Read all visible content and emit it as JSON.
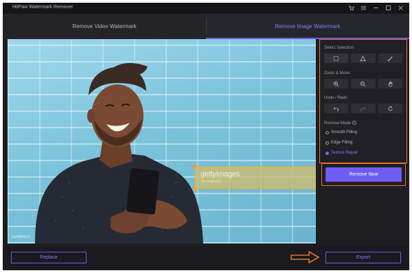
{
  "window": {
    "title": "HitPaw Watermark Remover"
  },
  "title_controls": [
    "cart-icon",
    "menu-icon",
    "minimize-icon",
    "maximize-icon",
    "close-icon"
  ],
  "tabs": [
    {
      "label": "Remove Video Watermark",
      "active": false
    },
    {
      "label": "Remove Image Watermark",
      "active": true
    }
  ],
  "canvas": {
    "watermark_text": "gettyimages",
    "watermark_subtext": "Tim Robberts",
    "corner_credit": "1183806072"
  },
  "panel": {
    "select_selection": "Select Selection",
    "select_tools": [
      "rectangle-select-icon",
      "polygon-select-icon",
      "brush-icon"
    ],
    "zoom_move": "Zoom & Move",
    "zoom_tools": [
      "zoom-in-icon",
      "zoom-out-icon",
      "hand-icon"
    ],
    "undo_redo": "Undo / Redo",
    "undo_tools": [
      "undo-icon",
      "redo-icon",
      "reset-icon"
    ],
    "remove_mode": "Remove Mode",
    "modes": [
      {
        "label": "Smooth Filling",
        "selected": false
      },
      {
        "label": "Edge Filling",
        "selected": false
      },
      {
        "label": "Texture Repair",
        "selected": true
      }
    ]
  },
  "actions": {
    "remove_now": "Remove Now",
    "replace": "Replace",
    "export": "Export"
  },
  "colors": {
    "accent": "#6f5cf0",
    "highlight": "#e8742a",
    "background": "#1d1d22"
  }
}
